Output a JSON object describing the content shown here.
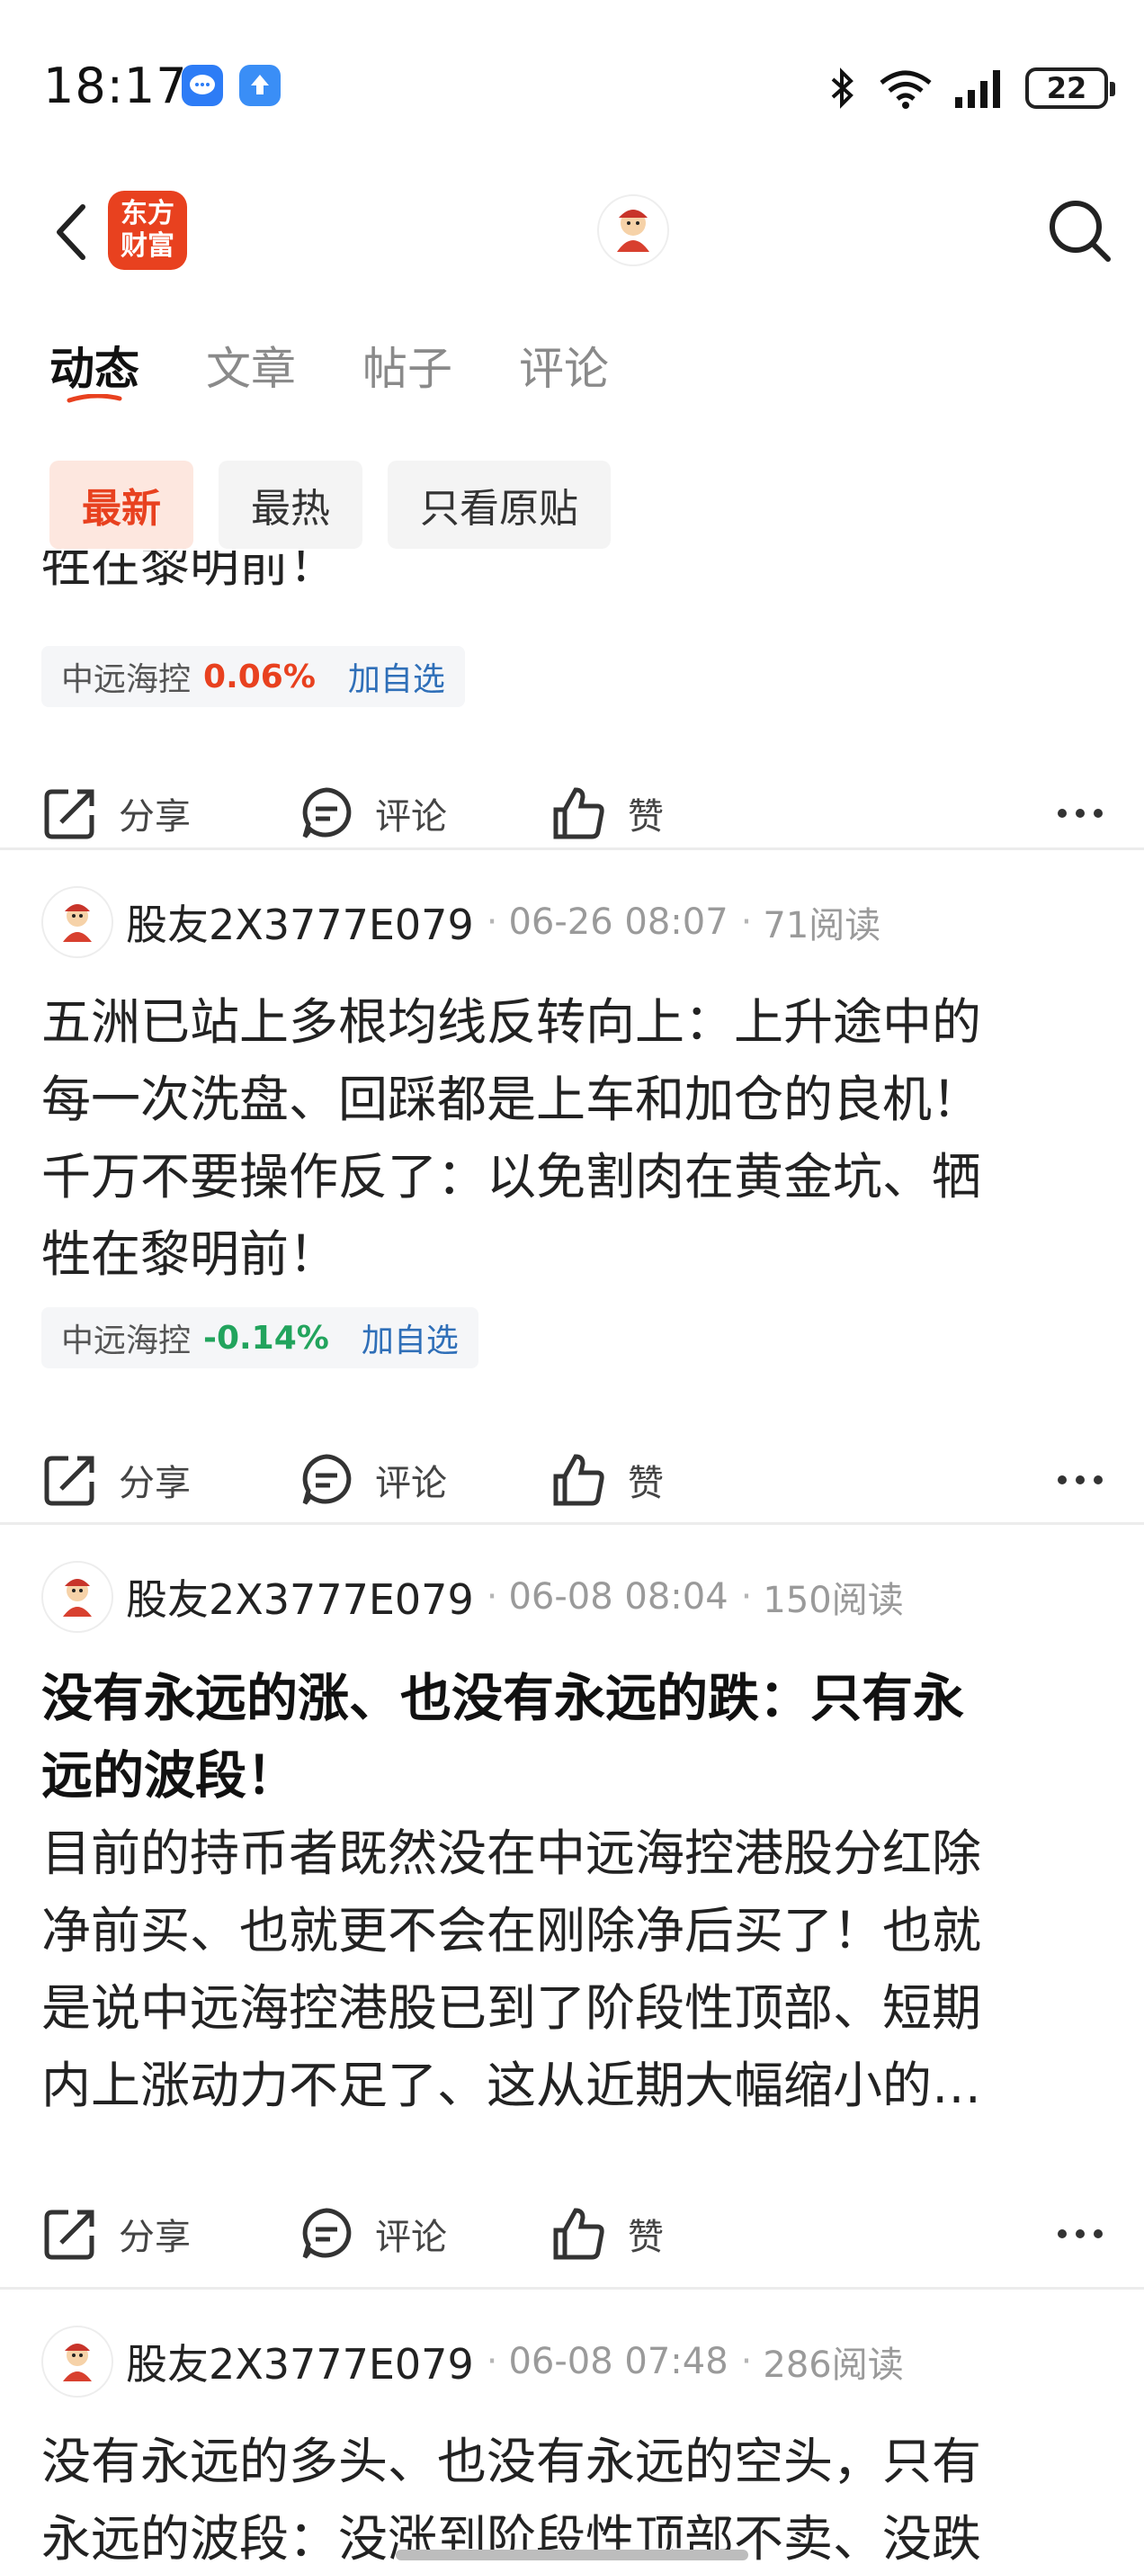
{
  "status_bar": {
    "time": "18:17",
    "battery": "22",
    "icons": [
      "chat-bubble-icon",
      "upload-icon",
      "bluetooth-icon",
      "wifi-icon",
      "signal-icon",
      "battery-icon"
    ]
  },
  "nav": {
    "brand_logo_text": "东方财富",
    "icons": [
      "back-icon",
      "avatar-icon",
      "search-icon"
    ]
  },
  "tabs": [
    {
      "label": "动态",
      "active": true
    },
    {
      "label": "文章",
      "active": false
    },
    {
      "label": "帖子",
      "active": false
    },
    {
      "label": "评论",
      "active": false
    }
  ],
  "filters": [
    {
      "label": "最新",
      "active": true
    },
    {
      "label": "最热",
      "active": false
    },
    {
      "label": "只看原贴",
      "active": false
    }
  ],
  "actions": {
    "share": "分享",
    "comment": "评论",
    "like": "赞"
  },
  "posts": [
    {
      "partial_text": "牲在黎明前！",
      "stock": {
        "name": "中远海控",
        "change": "0.06%",
        "add": "加自选",
        "color": "#e8411f"
      }
    },
    {
      "author": "股友2X3777E079",
      "date": "06-26 08:07",
      "reads": "71阅读",
      "body_lines": [
        "五洲已站上多根均线反转向上：上升途中的",
        "每一次洗盘、回踩都是上车和加仓的良机！",
        "千万不要操作反了：以免割肉在黄金坑、牺",
        "牲在黎明前！"
      ],
      "stock": {
        "name": "中远海控",
        "change": "-0.14%",
        "add": "加自选",
        "color": "#22a45d"
      }
    },
    {
      "author": "股友2X3777E079",
      "date": "06-08 08:04",
      "reads": "150阅读",
      "title_lines": [
        "没有永远的涨、也没有永远的跌：只有永",
        "远的波段！"
      ],
      "body_lines": [
        "目前的持币者既然没在中远海控港股分红除",
        "净前买、也就更不会在刚除净后买了！也就",
        "是说中远海控港股已到了阶段性顶部、短期",
        "内上涨动力不足了、这从近期大幅缩小的…"
      ]
    },
    {
      "author": "股友2X3777E079",
      "date": "06-08 07:48",
      "reads": "286阅读",
      "body_lines": [
        "没有永远的多头、也没有永远的空头，只有",
        "永远的波段：没涨到阶段性顶部不卖、没跌"
      ]
    }
  ],
  "colors": {
    "accent": "#e8411f",
    "link": "#2f6fb8",
    "up": "#e8411f",
    "down": "#22a45d"
  }
}
